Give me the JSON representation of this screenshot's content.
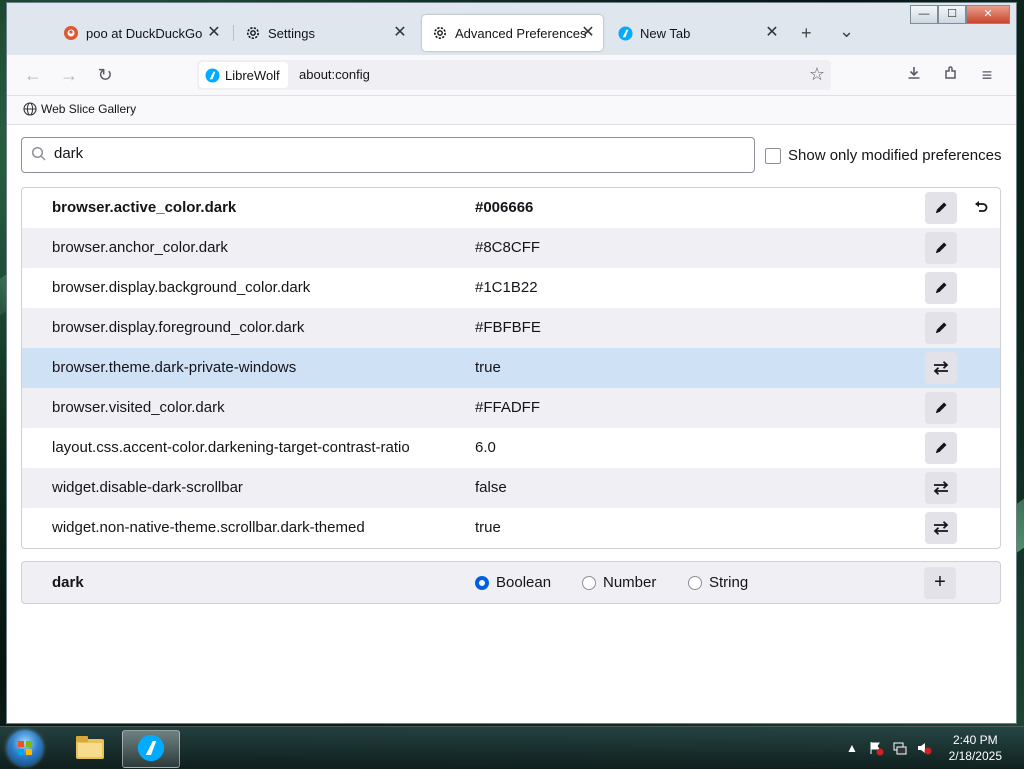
{
  "window": {
    "controls": {
      "minimize": "—",
      "maximize": "☐",
      "close": "✕"
    }
  },
  "tabs": [
    {
      "label": "poo at DuckDuckGo",
      "icon": "duckduckgo-icon",
      "active": false
    },
    {
      "label": "Settings",
      "icon": "gear-icon",
      "active": false
    },
    {
      "label": "Advanced Preferences",
      "icon": "gear-icon",
      "active": true
    },
    {
      "label": "New Tab",
      "icon": "librewolf-icon",
      "active": false
    }
  ],
  "tab_strip": {
    "new_tab": "+",
    "list_all": "⌄"
  },
  "urlbar": {
    "identity": "LibreWolf",
    "url": "about:config"
  },
  "bookmarks": [
    {
      "label": "Web Slice Gallery",
      "icon": "globe-icon"
    }
  ],
  "search": {
    "value": "dark"
  },
  "show_modified": {
    "label": "Show only modified preferences",
    "checked": false
  },
  "preferences": [
    {
      "name": "browser.active_color.dark",
      "value": "#006666",
      "action": "edit",
      "modified": true
    },
    {
      "name": "browser.anchor_color.dark",
      "value": "#8C8CFF",
      "action": "edit",
      "modified": false
    },
    {
      "name": "browser.display.background_color.dark",
      "value": "#1C1B22",
      "action": "edit",
      "modified": false
    },
    {
      "name": "browser.display.foreground_color.dark",
      "value": "#FBFBFE",
      "action": "edit",
      "modified": false
    },
    {
      "name": "browser.theme.dark-private-windows",
      "value": "true",
      "action": "toggle",
      "modified": false,
      "selected": true
    },
    {
      "name": "browser.visited_color.dark",
      "value": "#FFADFF",
      "action": "edit",
      "modified": false
    },
    {
      "name": "layout.css.accent-color.darkening-target-contrast-ratio",
      "value": "6.0",
      "action": "edit",
      "modified": false
    },
    {
      "name": "widget.disable-dark-scrollbar",
      "value": "false",
      "action": "toggle",
      "modified": false
    },
    {
      "name": "widget.non-native-theme.scrollbar.dark-themed",
      "value": "true",
      "action": "toggle",
      "modified": false
    }
  ],
  "add_pref": {
    "name": "dark",
    "types": [
      {
        "label": "Boolean",
        "selected": true
      },
      {
        "label": "Number",
        "selected": false
      },
      {
        "label": "String",
        "selected": false
      }
    ],
    "add_label": "+"
  },
  "taskbar": {
    "apps": [
      {
        "icon": "file-explorer-icon",
        "active": false
      },
      {
        "icon": "librewolf-icon",
        "active": true
      }
    ],
    "time": "2:40 PM",
    "date": "2/18/2025"
  },
  "colors": {
    "accent": "#0061e0",
    "selected_row": "#cfe1f5",
    "alt_row": "#f0f0f4"
  }
}
